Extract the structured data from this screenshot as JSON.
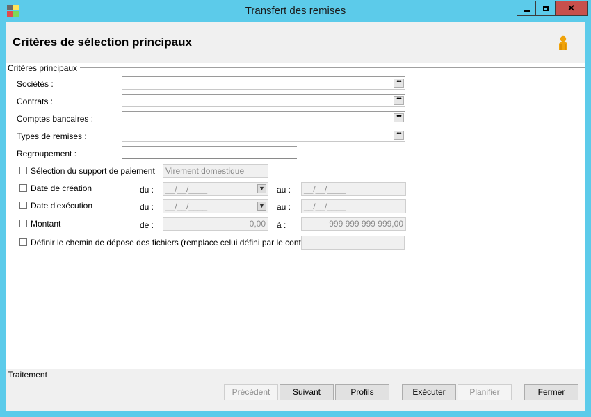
{
  "window": {
    "title": "Transfert des remises",
    "minimize": "▬",
    "maximize": "☐",
    "close": "✕"
  },
  "header": {
    "title": "Critères de sélection principaux",
    "user_icon": "user-icon"
  },
  "criteria": {
    "group_label": "Critères principaux",
    "societes_label": "Sociétés :",
    "contrats_label": "Contrats :",
    "comptes_label": "Comptes bancaires :",
    "types_label": "Types de remises :",
    "regroupement_label": "Regroupement :",
    "ellipsis": "•••",
    "support_label": "Sélection du support de paiement",
    "support_value": "Virement domestique",
    "creation_label": "Date de création",
    "execution_label": "Date d'exécution",
    "montant_label": "Montant",
    "du_label": "du :",
    "au_label": "au :",
    "de_label": "de :",
    "a_label": "à :",
    "date_mask": "__/__/____",
    "montant_from": "0,00",
    "montant_to": "999 999 999 999,00",
    "chemin_label": "Définir le chemin de dépose des fichiers (remplace celui défini par le contrat)"
  },
  "traitement": {
    "group_label": "Traitement",
    "buttons": {
      "precedent": "Précédent",
      "suivant": "Suivant",
      "profils": "Profils",
      "executer": "Exécuter",
      "planifier": "Planifier",
      "fermer": "Fermer"
    }
  },
  "colors": {
    "titlebar": "#5ccbea",
    "close": "#c7504c",
    "user_icon": "#f0a30a"
  }
}
